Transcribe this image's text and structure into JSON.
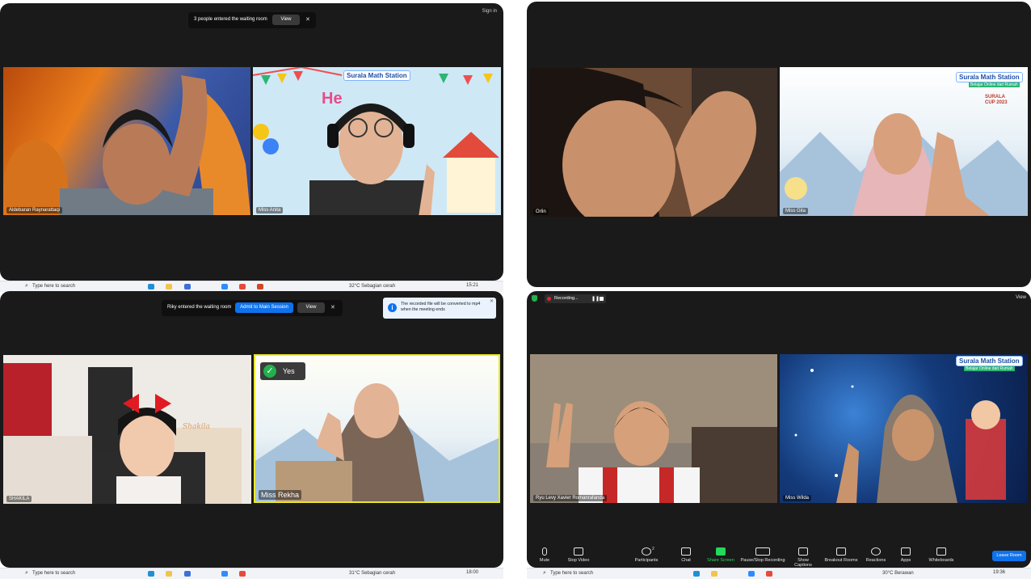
{
  "q1": {
    "topbar": {
      "signin": "Sign in"
    },
    "notification": {
      "text": "3 people entered the waiting room",
      "view": "View"
    },
    "participants": [
      {
        "name": "Aldebaran Raynarattaqi"
      },
      {
        "name": "Miss Anita"
      }
    ],
    "logo": "Surala Math Station",
    "banner_text": "He",
    "taskbar": {
      "search": "Type here to search",
      "weather": "32°C  Sebagian cerah",
      "time": "15:21"
    }
  },
  "q2": {
    "participants": [
      {
        "name": "Orlin"
      },
      {
        "name": "Miss Gita"
      }
    ],
    "logo": "Surala Math Station",
    "logo_sub": "Belajar Online dari Rumah",
    "cup": "SURALA CUP 2023"
  },
  "q3": {
    "notification": {
      "text": "Riky entered the waiting room",
      "admit": "Admit to Main Session",
      "view": "View"
    },
    "toast": {
      "text": "The recorded file will be converted to mp4 when the meeting ends"
    },
    "participants": [
      {
        "name": "SHAKILA"
      },
      {
        "name": "Miss Rekha"
      }
    ],
    "poster_text": "Shakila",
    "answer": "Yes",
    "taskbar": {
      "search": "Type here to search",
      "weather": "31°C  Sebagian cerah",
      "time": "18:00"
    }
  },
  "q4": {
    "recording": "Recording...",
    "view": "View",
    "participants": [
      {
        "name": "Ryu Levy Xavier Romanrafanda"
      },
      {
        "name": "Miss Wilda"
      }
    ],
    "logo": "Surala Math Station",
    "logo_sub": "Belajar Online dari Rumah",
    "toolbar": [
      {
        "label": "Mute"
      },
      {
        "label": "Stop Video"
      },
      {
        "label": "Participants",
        "count": "2"
      },
      {
        "label": "Chat"
      },
      {
        "label": "Share Screen"
      },
      {
        "label": "Pause/Stop Recording"
      },
      {
        "label": "Show Captions"
      },
      {
        "label": "Breakout Rooms"
      },
      {
        "label": "Reactions"
      },
      {
        "label": "Apps"
      },
      {
        "label": "Whiteboards"
      }
    ],
    "leave": "Leave Room",
    "taskbar": {
      "search": "Type here to search",
      "weather": "30°C  Berawan",
      "time": "19:36"
    }
  },
  "colors": {
    "zoom_blue": "#0e72ed",
    "share_green": "#23d959",
    "meeting_bg": "#1a1a1a"
  }
}
